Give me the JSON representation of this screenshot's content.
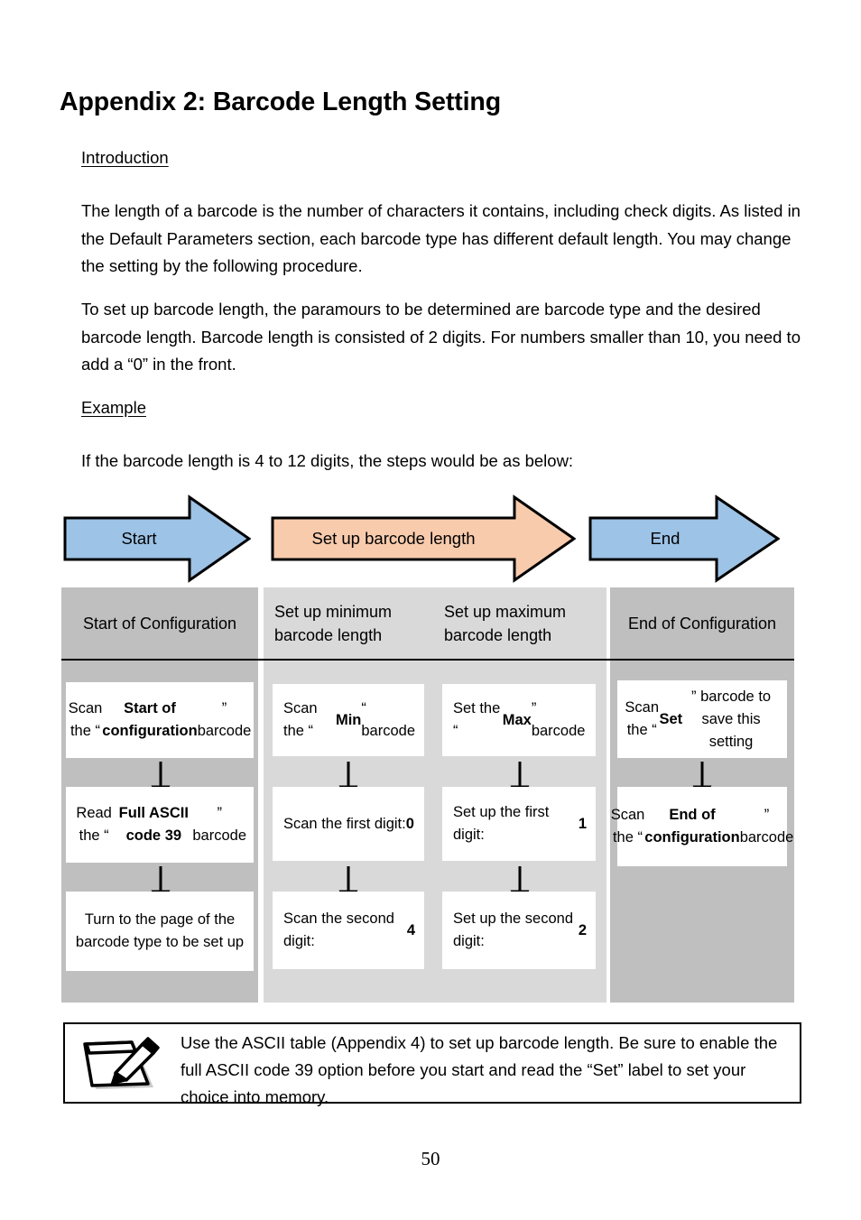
{
  "document": {
    "title": "Appendix 2: Barcode Length Setting",
    "page_number": "50"
  },
  "sections": {
    "introduction": {
      "heading": "Introduction",
      "paragraph_1": "The length of a barcode is the number of characters it contains, including check digits. As listed in the Default Parameters section, each barcode type has different default length. You may change the setting by the following procedure.",
      "paragraph_2": "To set up barcode length, the paramours to be determined are barcode type and the desired barcode length. Barcode length is consisted of 2 digits. For numbers smaller than 10, you need to add a “0” in the front."
    },
    "example": {
      "heading": "Example",
      "intro_line": "If the barcode length is 4 to 12 digits, the steps would be as below:"
    }
  },
  "flow_arrows": [
    {
      "label": "Start",
      "fill": "#9dc3e6",
      "stroke": "#000000"
    },
    {
      "label": "Set up barcode length",
      "fill": "#f8cbad",
      "stroke": "#000000"
    },
    {
      "label": "End",
      "fill": "#9dc3e6",
      "stroke": "#000000"
    }
  ],
  "flow_table": {
    "header_rule_color": "#000000",
    "column_bg_dark": "#bfbfbf",
    "column_bg_light": "#d9d9d9",
    "columns": [
      {
        "header": "Start of Configuration",
        "header_align": "centered",
        "bg": "dark",
        "cell_align": "centered",
        "cells": [
          {
            "parts": [
              {
                "text": "Scan the “",
                "bold": false
              },
              {
                "text": "Start of configuration",
                "bold": true
              },
              {
                "text": "” barcode",
                "bold": false
              }
            ]
          },
          {
            "parts": [
              {
                "text": "Read the “",
                "bold": false
              },
              {
                "text": "Full ASCII code 39",
                "bold": true
              },
              {
                "text": "” barcode",
                "bold": false
              }
            ]
          },
          {
            "parts": [
              {
                "text": "Turn to the page of the barcode type to be set up",
                "bold": false
              }
            ]
          }
        ]
      },
      {
        "header": "Set up minimum barcode length",
        "header_align": "lefted",
        "bg": "light",
        "cell_align": "lefted",
        "cells": [
          {
            "parts": [
              {
                "text": "Scan the “",
                "bold": false
              },
              {
                "text": "Min",
                "bold": true
              },
              {
                "text": "“ barcode",
                "bold": false
              }
            ]
          },
          {
            "parts": [
              {
                "text": "Scan the first digit: ",
                "bold": false
              },
              {
                "text": "0",
                "bold": true
              }
            ]
          },
          {
            "parts": [
              {
                "text": "Scan the second digit: ",
                "bold": false
              },
              {
                "text": "4",
                "bold": true
              }
            ]
          }
        ]
      },
      {
        "header": "Set up maximum barcode length",
        "header_align": "lefted",
        "bg": "light",
        "cell_align": "lefted",
        "cells": [
          {
            "parts": [
              {
                "text": "Set the “",
                "bold": false
              },
              {
                "text": "Max",
                "bold": true
              },
              {
                "text": "” barcode",
                "bold": false
              }
            ]
          },
          {
            "parts": [
              {
                "text": "Set up the first digit: ",
                "bold": false
              },
              {
                "text": "1",
                "bold": true
              }
            ]
          },
          {
            "parts": [
              {
                "text": "Set up the second digit: ",
                "bold": false
              },
              {
                "text": "2",
                "bold": true
              }
            ]
          }
        ]
      },
      {
        "header": "End of Configuration",
        "header_align": "centered",
        "bg": "dark",
        "cell_align": "centered",
        "cells": [
          {
            "parts": [
              {
                "text": "Scan the “",
                "bold": false
              },
              {
                "text": "Set",
                "bold": true
              },
              {
                "text": "” barcode to save this setting",
                "bold": false
              }
            ]
          },
          {
            "parts": [
              {
                "text": "Scan the “",
                "bold": false
              },
              {
                "text": "End of configuration",
                "bold": true
              },
              {
                "text": "” barcode",
                "bold": false
              }
            ]
          }
        ]
      }
    ]
  },
  "note": {
    "icon": "notepad-pencil-icon",
    "text": "Use the ASCII table (Appendix 4) to set up barcode length. Be sure to enable the full ASCII code 39 option before you start and read the “Set” label to set your choice into memory."
  }
}
